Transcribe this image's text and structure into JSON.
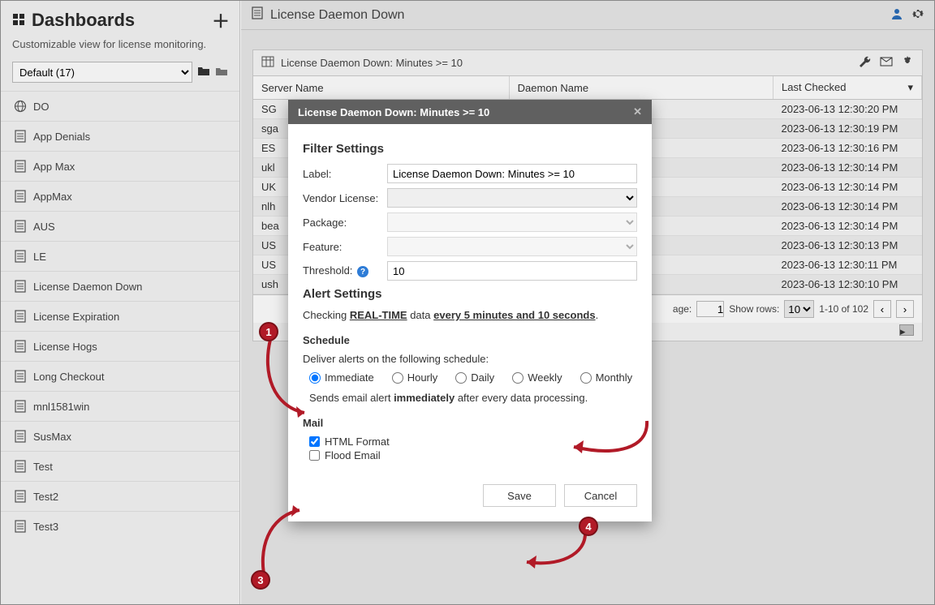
{
  "sidebar": {
    "title": "Dashboards",
    "subtitle": "Customizable view for license monitoring.",
    "selected_set": "Default (17)",
    "items": [
      {
        "label": "DO",
        "icon": "globe-icon"
      },
      {
        "label": "App Denials",
        "icon": "report-icon"
      },
      {
        "label": "App Max",
        "icon": "report-icon"
      },
      {
        "label": "AppMax",
        "icon": "report-icon"
      },
      {
        "label": "AUS",
        "icon": "report-icon"
      },
      {
        "label": "LE",
        "icon": "report-icon"
      },
      {
        "label": "License Daemon Down",
        "icon": "report-icon"
      },
      {
        "label": "License Expiration",
        "icon": "report-icon"
      },
      {
        "label": "License Hogs",
        "icon": "report-icon"
      },
      {
        "label": "Long Checkout",
        "icon": "report-icon"
      },
      {
        "label": "mnl1581win",
        "icon": "report-icon"
      },
      {
        "label": "SusMax",
        "icon": "report-icon"
      },
      {
        "label": "Test",
        "icon": "report-icon"
      },
      {
        "label": "Test2",
        "icon": "report-icon"
      },
      {
        "label": "Test3",
        "icon": "report-icon"
      }
    ]
  },
  "main": {
    "title": "License Daemon Down"
  },
  "panel": {
    "title": "License Daemon Down: Minutes >= 10",
    "columns": {
      "server": "Server Name",
      "daemon": "Daemon Name",
      "checked": "Last Checked"
    },
    "rows": [
      {
        "server": "SG",
        "daemon": "",
        "checked": "2023-06-13 12:30:20 PM"
      },
      {
        "server": "sga",
        "daemon": "",
        "checked": "2023-06-13 12:30:19 PM"
      },
      {
        "server": "ES",
        "daemon": "",
        "checked": "2023-06-13 12:30:16 PM"
      },
      {
        "server": "ukl",
        "daemon": "",
        "checked": "2023-06-13 12:30:14 PM"
      },
      {
        "server": "UK",
        "daemon": "",
        "checked": "2023-06-13 12:30:14 PM"
      },
      {
        "server": "nlh",
        "daemon": "",
        "checked": "2023-06-13 12:30:14 PM"
      },
      {
        "server": "bea",
        "daemon": "",
        "checked": "2023-06-13 12:30:14 PM"
      },
      {
        "server": "US",
        "daemon": "",
        "checked": "2023-06-13 12:30:13 PM"
      },
      {
        "server": "US",
        "daemon": "",
        "checked": "2023-06-13 12:30:11 PM"
      },
      {
        "server": "ush",
        "daemon": "",
        "checked": "2023-06-13 12:30:10 PM"
      }
    ],
    "pager": {
      "page_label": "age:",
      "page_value": "1",
      "show_rows_label": "Show rows:",
      "show_rows_value": "10",
      "range": "1-10 of 102"
    }
  },
  "modal": {
    "title": "License Daemon Down: Minutes >= 10",
    "filter_heading": "Filter Settings",
    "labels": {
      "label": "Label:",
      "vendor": "Vendor License:",
      "package": "Package:",
      "feature": "Feature:",
      "threshold": "Threshold:"
    },
    "values": {
      "label": "License Daemon Down: Minutes >= 10",
      "threshold": "10"
    },
    "alert_heading": "Alert Settings",
    "alert_prefix": "Checking ",
    "alert_realtime": "REAL-TIME",
    "alert_mid": " data ",
    "alert_interval": "every 5 minutes and 10 seconds",
    "alert_suffix": ".",
    "schedule_heading": "Schedule",
    "schedule_intro": "Deliver alerts on the following schedule:",
    "schedule_opts": [
      "Immediate",
      "Hourly",
      "Daily",
      "Weekly",
      "Monthly"
    ],
    "schedule_desc_pre": "Sends email alert ",
    "schedule_desc_bold": "immediately",
    "schedule_desc_post": " after every data processing.",
    "mail_heading": "Mail",
    "mail_html": "HTML Format",
    "mail_flood": "Flood Email",
    "save": "Save",
    "cancel": "Cancel"
  },
  "markers": {
    "m1": "1",
    "m3": "3",
    "m4": "4"
  }
}
